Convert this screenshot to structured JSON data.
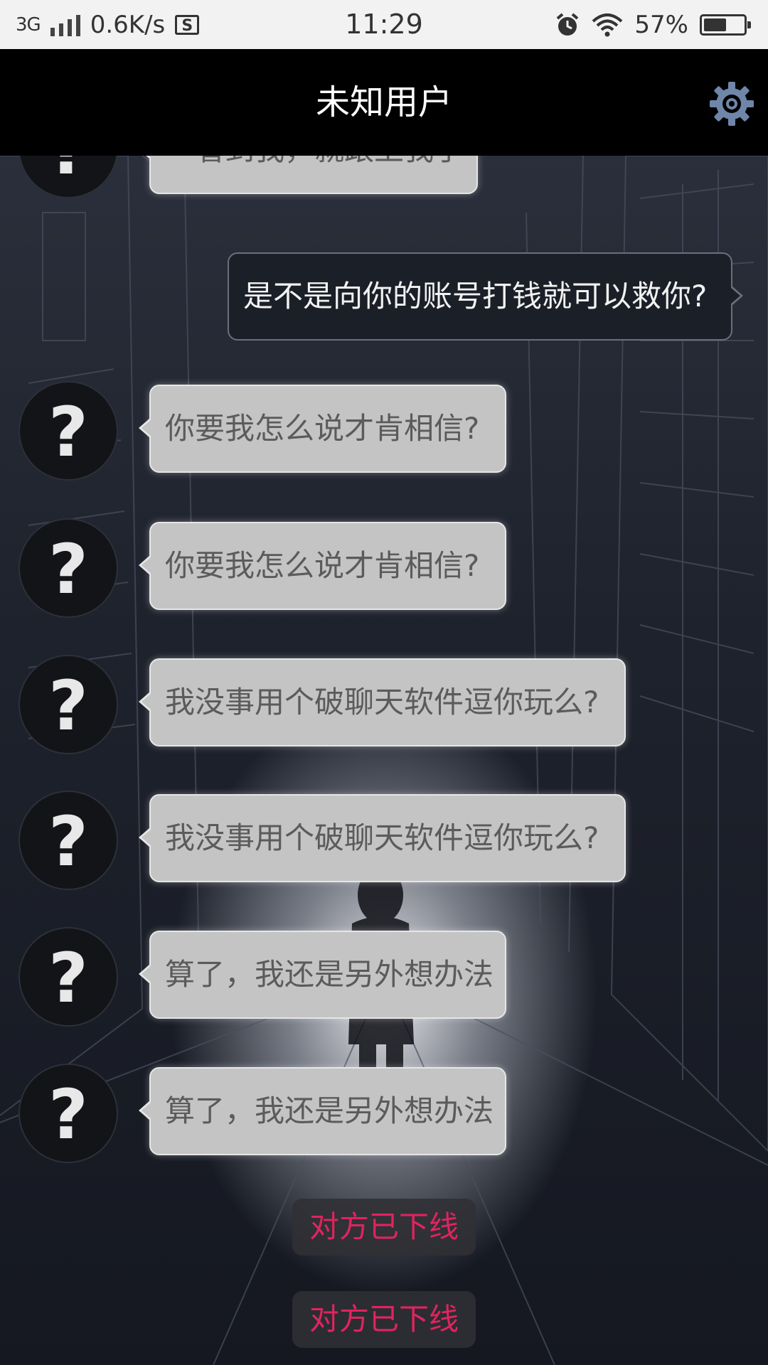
{
  "status_bar": {
    "network": "3G",
    "speed": "0.6K/s",
    "sd_icon_letter": "S",
    "time": "11:29",
    "battery": "57%",
    "battery_level": 0.57
  },
  "header": {
    "title": "未知用户",
    "settings_icon": "gear-icon",
    "settings_color": "#6f86a8"
  },
  "messages": [
    {
      "from": "other",
      "avatar": "?",
      "text": "一看到我，就跟上我了"
    },
    {
      "from": "me",
      "text": "是不是向你的账号打钱就可以救你?"
    },
    {
      "from": "other",
      "avatar": "?",
      "text": "你要我怎么说才肯相信?"
    },
    {
      "from": "other",
      "avatar": "?",
      "text": "你要我怎么说才肯相信?"
    },
    {
      "from": "other",
      "avatar": "?",
      "text": "我没事用个破聊天软件逗你玩么?"
    },
    {
      "from": "other",
      "avatar": "?",
      "text": "我没事用个破聊天软件逗你玩么?"
    },
    {
      "from": "other",
      "avatar": "?",
      "text": "算了，我还是另外想办法"
    },
    {
      "from": "other",
      "avatar": "?",
      "text": "算了，我还是另外想办法"
    }
  ],
  "notices": [
    "对方已下线",
    "对方已下线"
  ],
  "colors": {
    "notice_text": "#e0245e",
    "incoming_bubble": "#c4c4c4",
    "outgoing_bubble": "#1b1f28"
  }
}
